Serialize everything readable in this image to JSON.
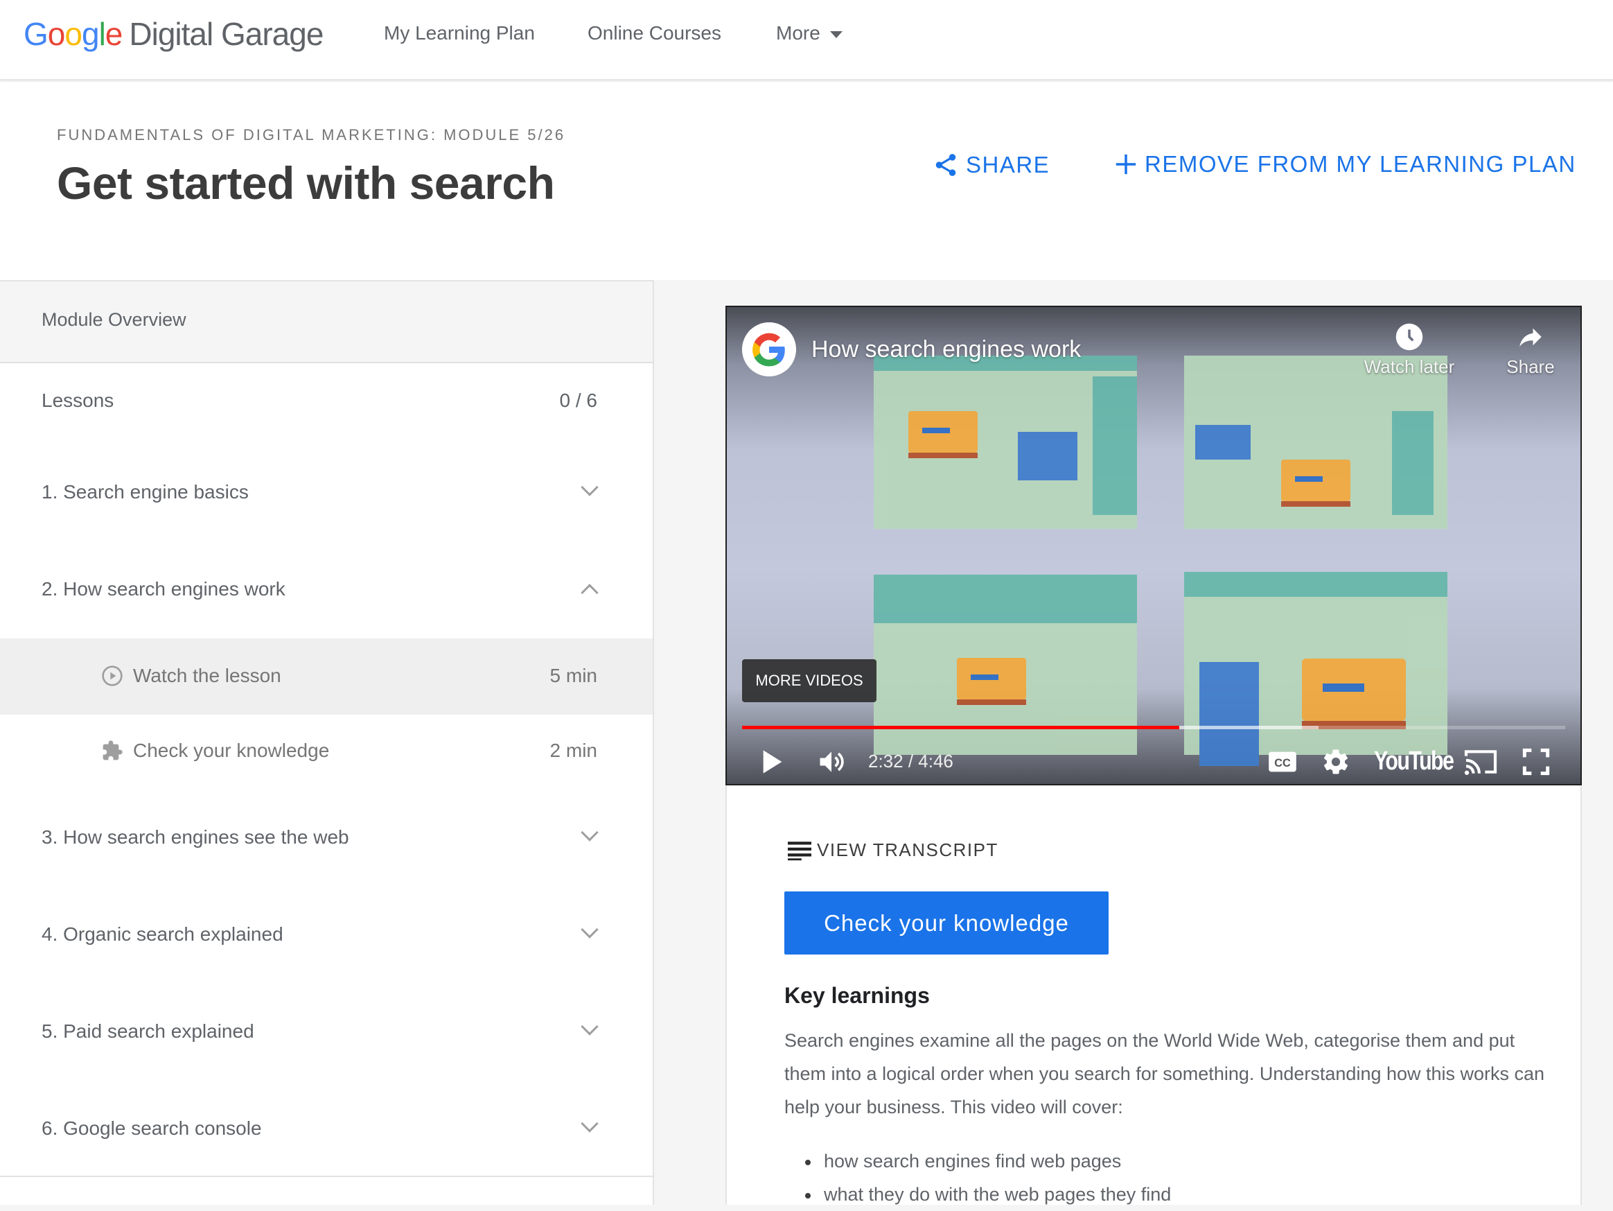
{
  "brand": {
    "logo_letters": [
      "G",
      "o",
      "o",
      "g",
      "l",
      "e"
    ],
    "logo_suffix": "Digital Garage",
    "colors": {
      "blue": "#4285f4",
      "red": "#ea4335",
      "yellow": "#fbbc05",
      "green": "#34a853",
      "accent": "#1a73e8"
    }
  },
  "nav": {
    "items": [
      {
        "label": "My Learning Plan"
      },
      {
        "label": "Online Courses"
      },
      {
        "label": "More",
        "icon": "caret-down-icon"
      }
    ]
  },
  "header": {
    "breadcrumb": "FUNDAMENTALS OF DIGITAL MARKETING: MODULE 5/26",
    "title": "Get started with search",
    "actions": {
      "share": {
        "label": "SHARE",
        "icon": "share-icon"
      },
      "remove": {
        "label": "REMOVE FROM MY LEARNING PLAN",
        "icon": "plus-icon"
      }
    }
  },
  "sidebar": {
    "overview_label": "Module Overview",
    "lessons_label": "Lessons",
    "lessons_progress": "0 / 6",
    "lessons": [
      {
        "label": "1. Search engine basics",
        "expanded": false
      },
      {
        "label": "2. How search engines work",
        "expanded": true,
        "subitems": [
          {
            "label": "Watch the lesson",
            "duration": "5 min",
            "icon": "play-circle-icon",
            "active": true
          },
          {
            "label": "Check your knowledge",
            "duration": "2 min",
            "icon": "puzzle-icon",
            "active": false
          }
        ]
      },
      {
        "label": "3. How search engines see the web",
        "expanded": false
      },
      {
        "label": "4. Organic search explained",
        "expanded": false
      },
      {
        "label": "5. Paid search explained",
        "expanded": false
      },
      {
        "label": "6. Google search console",
        "expanded": false
      }
    ]
  },
  "video": {
    "title": "How search engines work",
    "watch_later_label": "Watch later",
    "share_label": "Share",
    "more_videos_label": "MORE VIDEOS",
    "current_time": "2:32",
    "duration": "4:46",
    "time_display": "2:32 / 4:46",
    "played_fraction": 0.531,
    "buffered_fraction": 0.7,
    "brand_label": "YouTube",
    "progress_color": "#ff0000"
  },
  "content": {
    "transcript_label": "VIEW TRANSCRIPT",
    "check_button_label": "Check your knowledge",
    "key_learnings_title": "Key learnings",
    "key_learnings_text": "Search engines examine all the pages on the World Wide Web, categorise them and put them into a logical order when you search for something. Understanding how this works can help your business. This video will cover:",
    "bullets": [
      "how search engines find web pages",
      "what they do with the web pages they find"
    ]
  }
}
